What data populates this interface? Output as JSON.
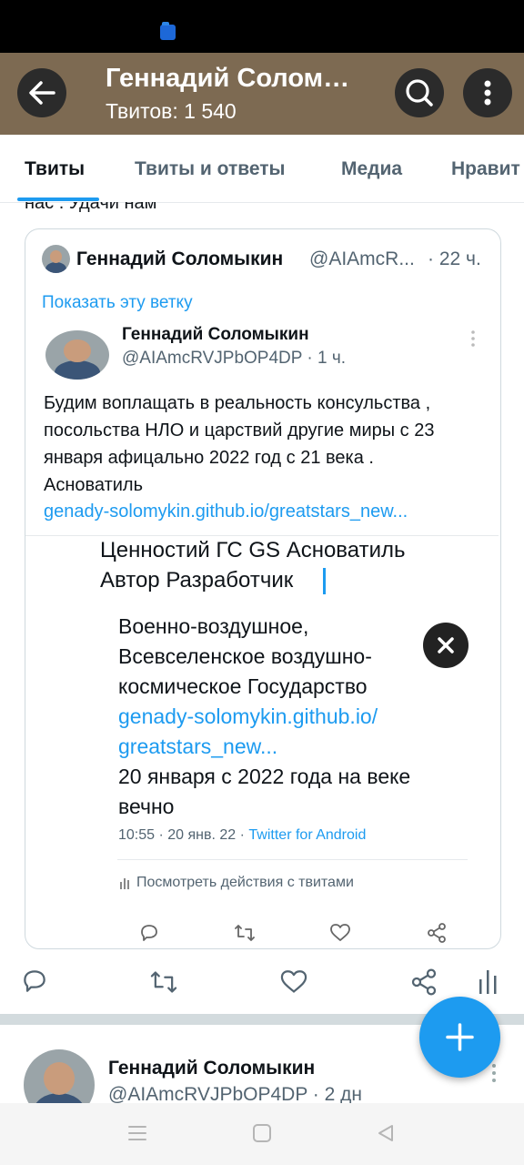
{
  "header": {
    "title": "Геннадий Солом…",
    "subtitle": "Твитов: 1 540"
  },
  "tabs": [
    {
      "label": "Твиты",
      "active": true
    },
    {
      "label": "Твиты и ответы",
      "active": false
    },
    {
      "label": "Медиа",
      "active": false
    },
    {
      "label": "Нравит",
      "active": false
    }
  ],
  "prev_tweet_tail": "нас . Удачи нам",
  "quoted_tweet": {
    "name": "Геннадий Соломыкин",
    "handle": "@AIAmcR...",
    "time": "· 22 ч.",
    "show_thread": "Показать эту ветку"
  },
  "inner_tweet": {
    "name": "Геннадий Соломыкин",
    "handle_time": "@AIAmcRVJPbOP4DP · 1 ч.",
    "lines": [
      "Будим воплащать в реальность консульства ,",
      "посольства НЛО и царствий другие миры с 23",
      "января афицально 2022 год с 21 века .",
      "Асноватиль"
    ],
    "link": "genady-solomykin.github.io/greatstars_new..."
  },
  "screenshot_tweet": {
    "heading_lines": [
      "Ценностий ГС GS Асноватиль",
      "Автор Разработчик"
    ],
    "body_lines": [
      "Военно-воздушное,",
      "Всевселенское воздушно-",
      "космическое Государство"
    ],
    "link_lines": [
      "genady-solomykin.github.io/",
      "greatstars_new..."
    ],
    "tail_lines": [
      "20 января с 2022 года на веке",
      "вечно"
    ],
    "meta_time": "10:55 · 20 янв. 22 · ",
    "meta_source": "Twitter for Android",
    "activity": "Посмотреть действия с твитами"
  },
  "next_tweet": {
    "name": "Геннадий Соломыкин",
    "handle_time": "@AIAmcRVJPbOP4DP · 2 дн"
  },
  "colors": {
    "appbar": "#7d6a52",
    "accent": "#1d9bf0",
    "text": "#0f1419",
    "secondary": "#536471"
  }
}
